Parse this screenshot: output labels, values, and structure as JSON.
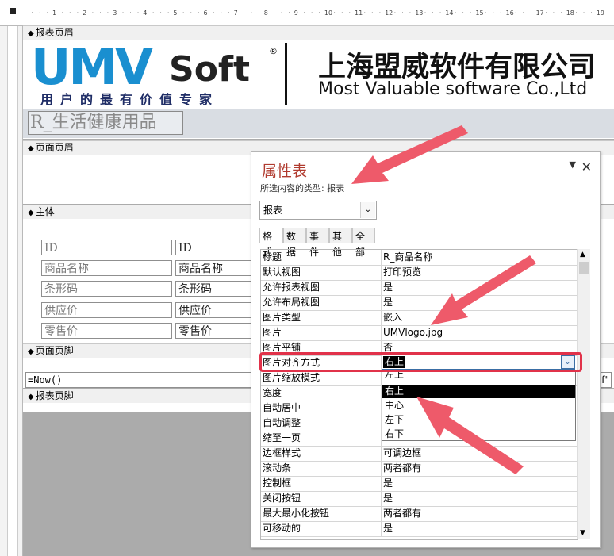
{
  "ruler": {
    "ticks": [
      "1",
      "2",
      "3",
      "4",
      "5",
      "6",
      "7",
      "8",
      "9",
      "10",
      "11",
      "12",
      "13",
      "14",
      "15",
      "16",
      "17",
      "18",
      "19"
    ]
  },
  "bands": {
    "report_header": "报表页眉",
    "page_header": "页面页眉",
    "detail": "主体",
    "page_footer": "页面页脚",
    "report_footer": "报表页脚"
  },
  "logo": {
    "brand_main": "UMV",
    "brand_soft": "Soft",
    "registered": "®",
    "slogan": "用户的最有价值专家",
    "company_cn": "上海盟威软件有限公司",
    "company_en": "Most Valuable software Co.,Ltd"
  },
  "report_title": "R_生活健康用品",
  "detail_fields": [
    {
      "label": "ID",
      "field": "ID"
    },
    {
      "label": "商品名称",
      "field": "商品名称"
    },
    {
      "label": "条形码",
      "field": "条形码"
    },
    {
      "label": "供应价",
      "field": "供应价"
    },
    {
      "label": "零售价",
      "field": "零售价"
    }
  ],
  "footer": {
    "now_expr": "=Now()",
    "right_fragment": "f\""
  },
  "property_sheet": {
    "title": "属性表",
    "subtitle": "所选内容的类型: 报表",
    "selector_value": "报表",
    "tabs": [
      "格式",
      "数据",
      "事件",
      "其他",
      "全部"
    ],
    "active_tab": "格式",
    "rows": [
      {
        "k": "标题",
        "v": "R_商品名称"
      },
      {
        "k": "默认视图",
        "v": "打印预览"
      },
      {
        "k": "允许报表视图",
        "v": "是"
      },
      {
        "k": "允许布局视图",
        "v": "是"
      },
      {
        "k": "图片类型",
        "v": "嵌入"
      },
      {
        "k": "图片",
        "v": "UMVlogo.jpg"
      },
      {
        "k": "图片平铺",
        "v": "否"
      },
      {
        "k": "图片对齐方式",
        "v": ""
      },
      {
        "k": "图片缩放模式",
        "v": ""
      },
      {
        "k": "宽度",
        "v": ""
      },
      {
        "k": "自动居中",
        "v": ""
      },
      {
        "k": "自动调整",
        "v": ""
      },
      {
        "k": "缩至一页",
        "v": ""
      },
      {
        "k": "边框样式",
        "v": "可调边框"
      },
      {
        "k": "滚动条",
        "v": "两者都有"
      },
      {
        "k": "控制框",
        "v": "是"
      },
      {
        "k": "关闭按钮",
        "v": "是"
      },
      {
        "k": "最大最小化按钮",
        "v": "两者都有"
      },
      {
        "k": "可移动的",
        "v": "是"
      }
    ],
    "dropdown": {
      "current": "右上",
      "options": [
        "左上",
        "右上",
        "中心",
        "左下",
        "右下"
      ],
      "selected_index": 1
    }
  },
  "colors": {
    "accent_red": "#e1324a",
    "logo_blue": "#1a8fd0",
    "title_red": "#b03a2e"
  }
}
